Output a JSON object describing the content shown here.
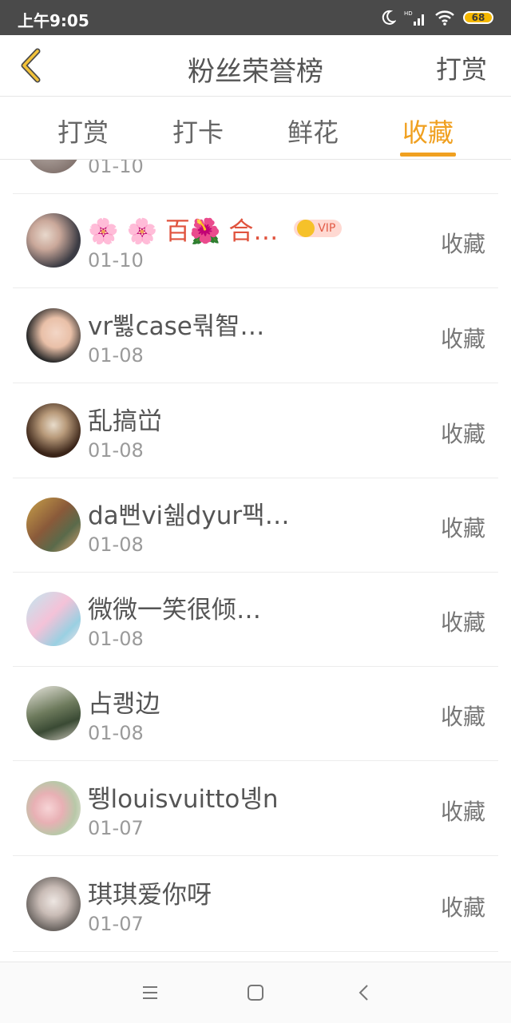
{
  "status": {
    "time": "上午9:05",
    "battery": "68"
  },
  "header": {
    "title": "粉丝荣誉榜",
    "action_label": "打赏"
  },
  "tabs": [
    {
      "label": "打赏",
      "active": false
    },
    {
      "label": "打卡",
      "active": false
    },
    {
      "label": "鲜花",
      "active": false
    },
    {
      "label": "收藏",
      "active": true
    }
  ],
  "accent_color": "#f0a020",
  "list": {
    "collect_label": "收藏",
    "vip_label": "VIP",
    "rows": [
      {
        "name": "",
        "date": "01-10"
      },
      {
        "name": "🌸 🌸 百🌺 合…",
        "date": "01-10",
        "vip": true
      },
      {
        "name": "vr뾣case뤆智…",
        "date": "01-08"
      },
      {
        "name": "乱搞峃",
        "date": "01-08"
      },
      {
        "name": "da뻔vi쉚dyur팩…",
        "date": "01-08"
      },
      {
        "name": "微微一笑很倾…",
        "date": "01-08"
      },
      {
        "name": "占쾡边",
        "date": "01-08"
      },
      {
        "name": "뙝louisvuitto녱n",
        "date": "01-07"
      },
      {
        "name": "琪琪爱你呀",
        "date": "01-07"
      }
    ]
  }
}
